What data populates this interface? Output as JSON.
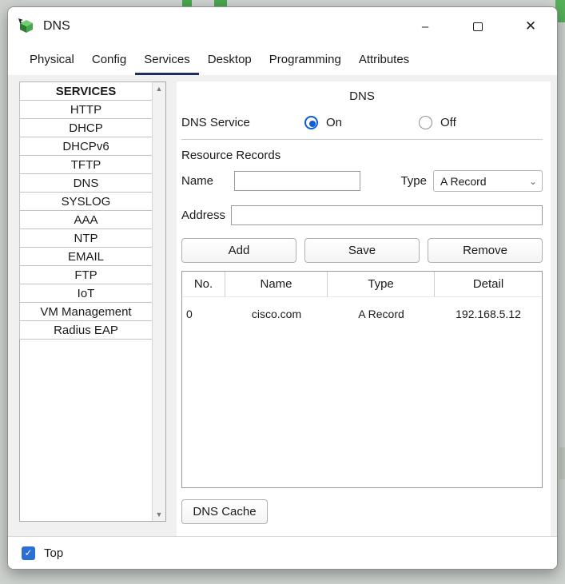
{
  "window": {
    "title": "DNS",
    "controls": {
      "minimize": "–",
      "close": "✕"
    }
  },
  "tabs": [
    {
      "label": "Physical"
    },
    {
      "label": "Config"
    },
    {
      "label": "Services"
    },
    {
      "label": "Desktop"
    },
    {
      "label": "Programming"
    },
    {
      "label": "Attributes"
    }
  ],
  "sidebar": {
    "header": "SERVICES",
    "items": [
      "HTTP",
      "DHCP",
      "DHCPv6",
      "TFTP",
      "DNS",
      "SYSLOG",
      "AAA",
      "NTP",
      "EMAIL",
      "FTP",
      "IoT",
      "VM Management",
      "Radius EAP"
    ],
    "scrollbar": {
      "up": "▲",
      "down": "▼"
    }
  },
  "main": {
    "heading": "DNS",
    "dns_service_label": "DNS Service",
    "dns_service_state": "On",
    "on_label": "On",
    "off_label": "Off",
    "resource_records_label": "Resource Records",
    "name_label": "Name",
    "name_value": "",
    "type_label": "Type",
    "type_value": "A Record",
    "type_chevron": "⌄",
    "address_label": "Address",
    "address_value": "",
    "buttons": {
      "add": "Add",
      "save": "Save",
      "remove": "Remove"
    },
    "table": {
      "headers": [
        "No.",
        "Name",
        "Type",
        "Detail"
      ],
      "rows": [
        [
          "0",
          "cisco.com",
          "A Record",
          "192.168.5.12"
        ]
      ]
    },
    "dns_cache_button": "DNS Cache"
  },
  "footer": {
    "top_label": "Top",
    "checkbox_checked": true,
    "check_glyph": "✓"
  },
  "colors": {
    "accent_blue": "#0b5ed7",
    "tab_underline": "#1c2e63",
    "icon_green": "#3f9e45"
  }
}
